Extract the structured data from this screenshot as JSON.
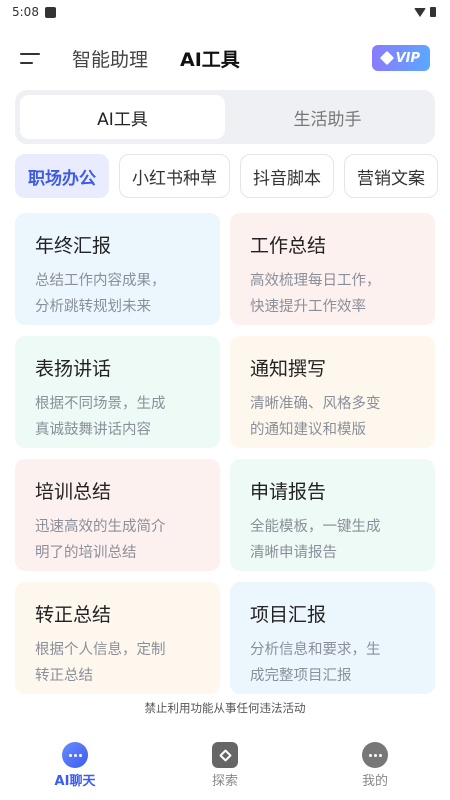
{
  "status": {
    "time": "5:08"
  },
  "header": {
    "tabs": [
      {
        "label": "智能助理"
      },
      {
        "label": "AI工具"
      }
    ],
    "vip": "VIP"
  },
  "segment": [
    {
      "label": "AI工具"
    },
    {
      "label": "生活助手"
    }
  ],
  "chips": [
    "职场办公",
    "小红书种草",
    "抖音脚本",
    "营销文案"
  ],
  "cards": [
    {
      "title": "年终汇报",
      "desc": [
        "总结工作内容成果，",
        "分析跳转规划未来"
      ]
    },
    {
      "title": "工作总结",
      "desc": [
        "高效梳理每日工作，",
        "快速提升工作效率"
      ]
    },
    {
      "title": "表扬讲话",
      "desc": [
        "根据不同场景，生成",
        "真诚鼓舞讲话内容"
      ]
    },
    {
      "title": "通知撰写",
      "desc": [
        "清晰准确、风格多变",
        "的通知建议和模版"
      ]
    },
    {
      "title": "培训总结",
      "desc": [
        "迅速高效的生成简介",
        "明了的培训总结"
      ]
    },
    {
      "title": "申请报告",
      "desc": [
        "全能模板，一键生成",
        "清晰申请报告"
      ]
    },
    {
      "title": "转正总结",
      "desc": [
        "根据个人信息，定制",
        "转正总结"
      ]
    },
    {
      "title": "项目汇报",
      "desc": [
        "分析信息和要求，生",
        "成完整项目汇报"
      ]
    }
  ],
  "notice": "禁止利用功能从事任何违法活动",
  "nav": [
    {
      "label": "AI聊天"
    },
    {
      "label": "探索"
    },
    {
      "label": "我的"
    }
  ]
}
